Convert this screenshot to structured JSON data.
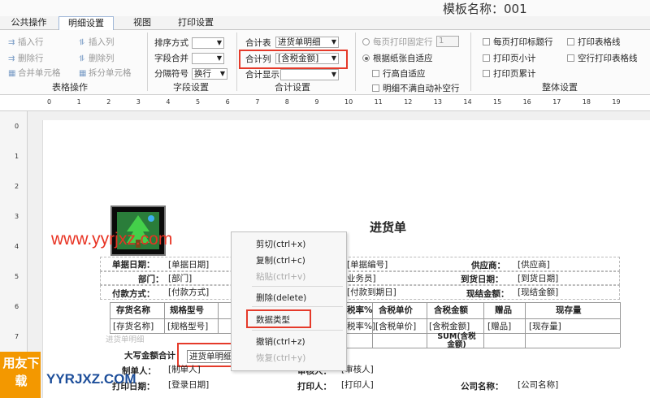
{
  "title": "模板名称：001",
  "tabs": [
    "公共操作",
    "明细设置",
    "视图",
    "打印设置"
  ],
  "table_ops": {
    "insert_row": "插入行",
    "insert_col": "插入列",
    "delete_row": "删除行",
    "delete_col": "删除列",
    "merge_cells": "合并单元格",
    "split_cells": "拆分单元格",
    "group": "表格操作"
  },
  "field_settings": {
    "sort_label": "排序方式",
    "merge_label": "字段合并",
    "separator_label": "分隔符号",
    "separator_value": "换行",
    "group": "字段设置"
  },
  "total_settings": {
    "table_label": "合计表",
    "table_value": "进货单明细",
    "column_label": "合计列",
    "column_value": "[含税金额]",
    "display_label": "合计显示",
    "group": "合计设置"
  },
  "page_options": {
    "fixed_rows": "每页打印固定行",
    "fixed_rows_value": "1",
    "auto_fit_paper": "根据纸张自适应",
    "row_height_fit": "行高自适应",
    "auto_fill_rows": "明细不满自动补空行"
  },
  "overall_settings": {
    "print_header_each_page": "每页打印标题行",
    "page_subtotal": "打印页小计",
    "page_cumulative": "打印页累计",
    "print_grid": "打印表格线",
    "print_empty_grid": "空行打印表格线",
    "group": "整体设置"
  },
  "ruler_h": [
    "0",
    "1",
    "2",
    "3",
    "4",
    "5",
    "6",
    "7",
    "8",
    "9",
    "10",
    "11",
    "12",
    "13",
    "14",
    "15",
    "16",
    "17",
    "18",
    "19"
  ],
  "ruler_v": [
    "0",
    "1",
    "2",
    "3",
    "4",
    "5",
    "6",
    "7"
  ],
  "report": {
    "title": "进货单",
    "doc_date_label": "单据日期：",
    "doc_date": "[单据日期]",
    "doc_no": "[单据编号]",
    "supplier_label": "供应商：",
    "supplier": "[供应商]",
    "dept_label": "部门：",
    "dept": "[部门]",
    "salesman": "业务员]",
    "arrival_label": "到货日期：",
    "arrival": "[到货日期]",
    "payment_label": "付款方式：",
    "payment": "[付款方式]",
    "pay_due": "[付款到期日]",
    "cash_label": "现结金额：",
    "cash": "[现结金额]",
    "columns": [
      "存货名称",
      "规格型号",
      "税率%",
      "含税单价",
      "含税金额",
      "赠品",
      "现存量"
    ],
    "col_fields": [
      "[存货名称]",
      "[规格型号]",
      "税率%]",
      "[含税单价]",
      "[含税金额]",
      "[赠品]",
      "[现存量]"
    ],
    "sum_cell": "SUM(含税金额)",
    "detail_note": "进货单明细",
    "capital_total": "大写金额合计",
    "tooltip_value": "进货单明细",
    "maker_label": "制单人：",
    "maker": "[制单人]",
    "approver_label": "审核人：",
    "approver": "[审核人]",
    "print_date_label": "打印日期：",
    "print_date": "[登录日期]",
    "printer_label": "打印人：",
    "printer": "[打印人]",
    "company_label": "公司名称：",
    "company": "[公司名称]"
  },
  "context_menu": {
    "cut": "剪切(ctrl+x)",
    "copy": "复制(ctrl+c)",
    "paste": "粘贴(ctrl+v)",
    "delete": "删除(delete)",
    "data_type": "数据类型",
    "undo": "撤销(ctrl+z)",
    "redo": "恢复(ctrl+y)"
  },
  "watermark": {
    "url": "www.yyrjxz.com",
    "badge": "用友下载",
    "brand": "YYRJXZ.COM"
  },
  "colors": {
    "highlight": "#e53a2a",
    "badge": "#f39800",
    "brand": "#1d4e9a"
  }
}
